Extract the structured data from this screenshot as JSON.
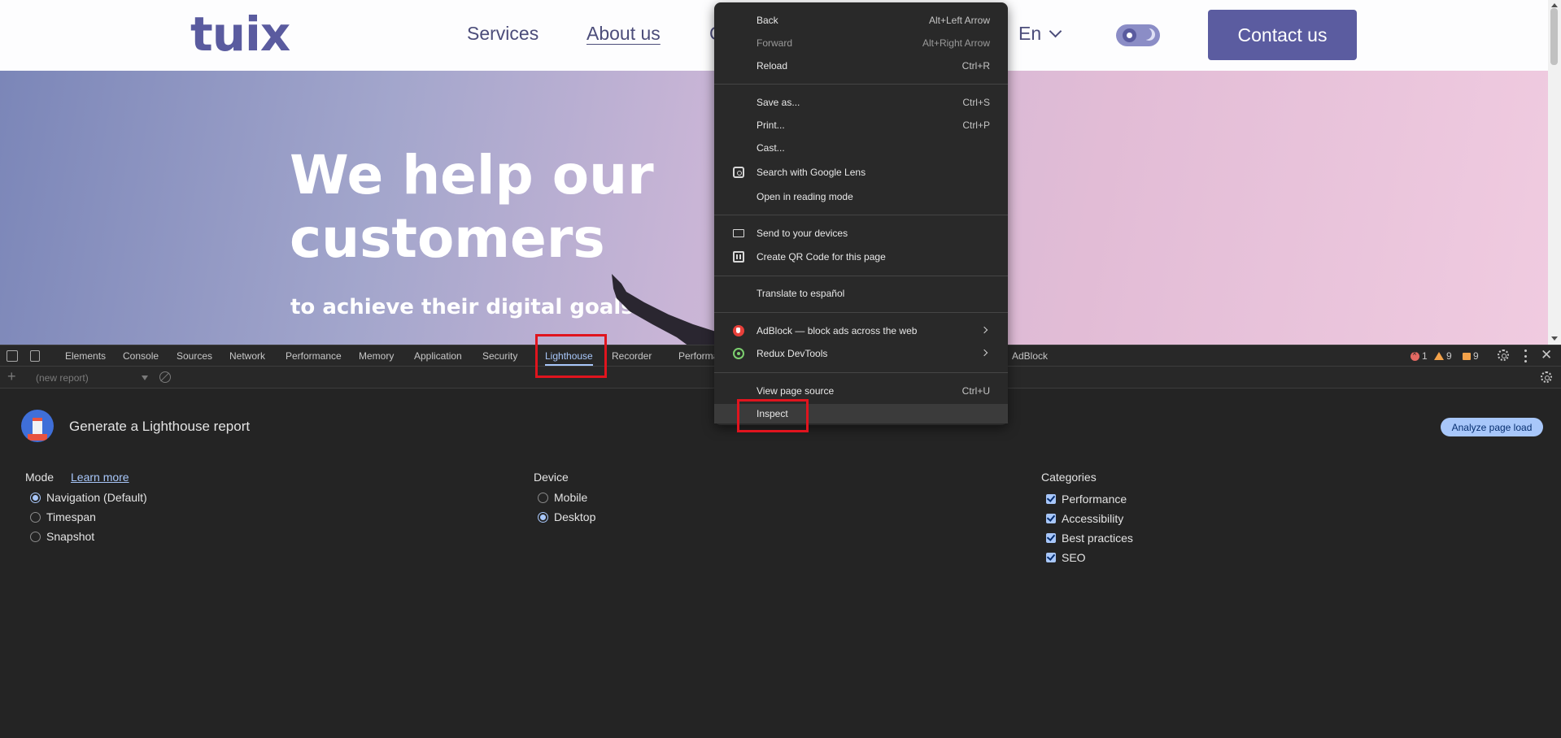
{
  "site": {
    "logo": "tuix",
    "nav": [
      "Services",
      "About us",
      "C"
    ],
    "language": "En",
    "contact_label": "Contact us",
    "hero_title": "We help our customers",
    "hero_subtitle": "to achieve their digital goals"
  },
  "devtools": {
    "tabs": [
      "Elements",
      "Console",
      "Sources",
      "Network",
      "Performance",
      "Memory",
      "Application",
      "Security",
      "Lighthouse",
      "Recorder",
      "Performa",
      "AdBlock"
    ],
    "selected_tab": "Lighthouse",
    "issues": {
      "errors": "1",
      "warnings": "9",
      "info": "9"
    },
    "toolbar": {
      "report_placeholder": "(new report)"
    }
  },
  "lighthouse": {
    "title": "Generate a Lighthouse report",
    "analyze_label": "Analyze page load",
    "mode_label": "Mode",
    "learn_more": "Learn more",
    "modes": [
      {
        "label": "Navigation (Default)",
        "selected": true
      },
      {
        "label": "Timespan",
        "selected": false
      },
      {
        "label": "Snapshot",
        "selected": false
      }
    ],
    "device_label": "Device",
    "devices": [
      {
        "label": "Mobile",
        "selected": false
      },
      {
        "label": "Desktop",
        "selected": true
      }
    ],
    "categories_label": "Categories",
    "categories": [
      "Performance",
      "Accessibility",
      "Best practices",
      "SEO"
    ]
  },
  "context_menu": {
    "items": [
      {
        "label": "Back",
        "shortcut": "Alt+Left Arrow"
      },
      {
        "label": "Forward",
        "shortcut": "Alt+Right Arrow"
      },
      {
        "label": "Reload",
        "shortcut": "Ctrl+R"
      },
      {
        "label": "Save as...",
        "shortcut": "Ctrl+S"
      },
      {
        "label": "Print...",
        "shortcut": "Ctrl+P"
      },
      {
        "label": "Cast...",
        "shortcut": ""
      },
      {
        "label": "Search with Google Lens",
        "shortcut": "",
        "icon": "google-lens-icon"
      },
      {
        "label": "Open in reading mode",
        "shortcut": ""
      },
      {
        "label": "Send to your devices",
        "shortcut": "",
        "icon": "devices-icon"
      },
      {
        "label": "Create QR Code for this page",
        "shortcut": "",
        "icon": "qr-code-icon"
      },
      {
        "label": "Translate to español",
        "shortcut": ""
      },
      {
        "label": "AdBlock — block ads across the web",
        "shortcut": "",
        "icon": "adblock-icon"
      },
      {
        "label": "Redux DevTools",
        "shortcut": "",
        "icon": "redux-icon"
      },
      {
        "label": "View page source",
        "shortcut": "Ctrl+U"
      },
      {
        "label": "Inspect",
        "shortcut": ""
      }
    ]
  }
}
